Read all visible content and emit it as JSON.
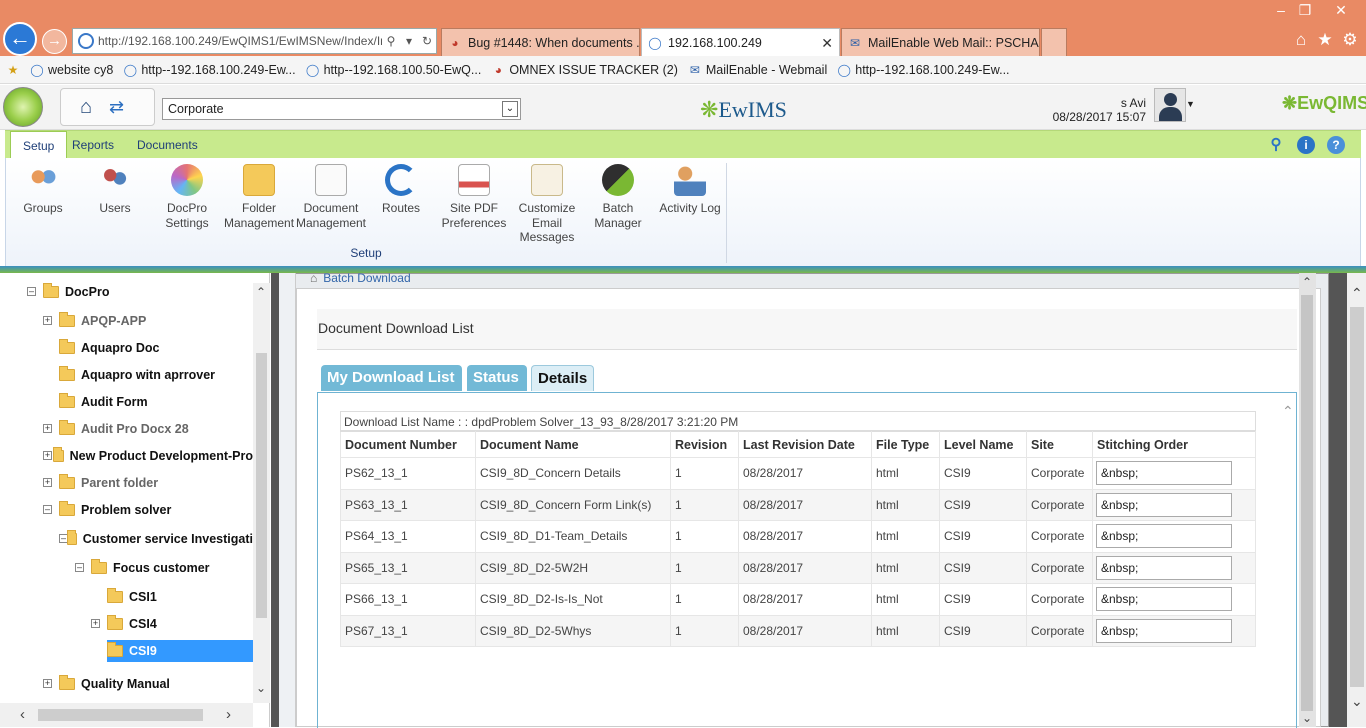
{
  "browser": {
    "address_url": "http://192.168.100.249/EwQIMS1/EwIMSNew/Index/In",
    "tabs": [
      {
        "label": "Bug #1448: When documents ..."
      },
      {
        "label": "192.168.100.249"
      },
      {
        "label": "MailEnable Web Mail:: PSCHA..."
      }
    ],
    "favorites": [
      {
        "label": "website cy8"
      },
      {
        "label": "http--192.168.100.249-Ew..."
      },
      {
        "label": "http--192.168.100.50-EwQ..."
      },
      {
        "label": "OMNEX ISSUE TRACKER (2)"
      },
      {
        "label": "MailEnable - Webmail"
      },
      {
        "label": "http--192.168.100.249-Ew..."
      }
    ]
  },
  "header": {
    "site_select": "Corporate",
    "center_logo": "EwIMS",
    "user_name": "s Avi",
    "datetime": "08/28/2017 15:07",
    "right_logo": "EwQIMS"
  },
  "ribbon": {
    "tabs": [
      {
        "label": "Setup"
      },
      {
        "label": "Reports"
      },
      {
        "label": "Documents"
      }
    ],
    "buttons": [
      {
        "label": "Groups"
      },
      {
        "label": "Users"
      },
      {
        "label": "DocPro Settings"
      },
      {
        "label": "Folder Management"
      },
      {
        "label": "Document Management"
      },
      {
        "label": "Routes"
      },
      {
        "label": "Site PDF Preferences"
      },
      {
        "label": "Customize Email Messages"
      },
      {
        "label": "Batch Manager"
      },
      {
        "label": "Activity Log"
      }
    ],
    "group_label": "Setup"
  },
  "tree": {
    "nodes": [
      {
        "label": "DocPro"
      },
      {
        "label": "APQP-APP"
      },
      {
        "label": "Aquapro Doc"
      },
      {
        "label": "Aquapro witn aprrover"
      },
      {
        "label": "Audit Form"
      },
      {
        "label": "Audit Pro Docx 28"
      },
      {
        "label": "New Product Development-Pro"
      },
      {
        "label": "Parent folder"
      },
      {
        "label": "Problem solver"
      },
      {
        "label": "Customer service Investigati"
      },
      {
        "label": "Focus customer"
      },
      {
        "label": "CSI1"
      },
      {
        "label": "CSI4"
      },
      {
        "label": "CSI9"
      },
      {
        "label": "Quality Manual"
      }
    ]
  },
  "main": {
    "breadcrumb": "Batch Download",
    "dialog_title": "Document Download List",
    "tabs": [
      {
        "label": "My Download List"
      },
      {
        "label": "Status"
      },
      {
        "label": "Details"
      }
    ],
    "download_list_name": "Download List Name : : dpdProblem Solver_13_93_8/28/2017 3:21:20 PM",
    "columns": [
      "Document Number",
      "Document Name",
      "Revision",
      "Last Revision Date",
      "File Type",
      "Level Name",
      "Site",
      "Stitching Order"
    ],
    "rows": [
      {
        "number": "PS62_13_1",
        "name": "CSI9_8D_Concern Details",
        "revision": "1",
        "date": "08/28/2017",
        "type": "html",
        "level": "CSI9",
        "site": "Corporate",
        "order": "&nbsp;"
      },
      {
        "number": "PS63_13_1",
        "name": "CSI9_8D_Concern Form Link(s)",
        "revision": "1",
        "date": "08/28/2017",
        "type": "html",
        "level": "CSI9",
        "site": "Corporate",
        "order": "&nbsp;"
      },
      {
        "number": "PS64_13_1",
        "name": "CSI9_8D_D1-Team_Details",
        "revision": "1",
        "date": "08/28/2017",
        "type": "html",
        "level": "CSI9",
        "site": "Corporate",
        "order": "&nbsp;"
      },
      {
        "number": "PS65_13_1",
        "name": "CSI9_8D_D2-5W2H",
        "revision": "1",
        "date": "08/28/2017",
        "type": "html",
        "level": "CSI9",
        "site": "Corporate",
        "order": "&nbsp;"
      },
      {
        "number": "PS66_13_1",
        "name": "CSI9_8D_D2-Is-Is_Not",
        "revision": "1",
        "date": "08/28/2017",
        "type": "html",
        "level": "CSI9",
        "site": "Corporate",
        "order": "&nbsp;"
      },
      {
        "number": "PS67_13_1",
        "name": "CSI9_8D_D2-5Whys",
        "revision": "1",
        "date": "08/28/2017",
        "type": "html",
        "level": "CSI9",
        "site": "Corporate",
        "order": "&nbsp;"
      }
    ]
  },
  "colors": {
    "titlebar": "#e98a64",
    "ribbon_tabs": "#c8ea8d",
    "selection": "#3399ff",
    "tab_blue": "#72b9d6"
  }
}
